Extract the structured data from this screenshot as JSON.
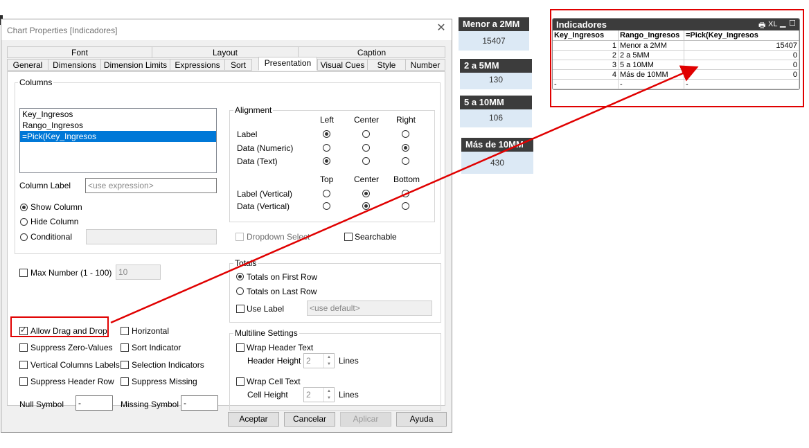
{
  "dialog": {
    "title": "Chart Properties [Indicadores]",
    "tabs_row1": [
      "Font",
      "Layout",
      "Caption"
    ],
    "tabs_row2": [
      "General",
      "Dimensions",
      "Dimension Limits",
      "Expressions",
      "Sort",
      "Presentation",
      "Visual Cues",
      "Style",
      "Number"
    ],
    "active_tab": "Presentation"
  },
  "columns": {
    "label": "Columns",
    "items": [
      "Key_Ingresos",
      "Rango_Ingresos",
      "=Pick(Key_Ingresos"
    ],
    "selected_index": 2,
    "column_label": "Column Label",
    "column_label_placeholder": "<use expression>",
    "show_column": "Show Column",
    "hide_column": "Hide Column",
    "conditional": "Conditional"
  },
  "alignment": {
    "label": "Alignment",
    "headers": [
      "Left",
      "Center",
      "Right"
    ],
    "rows": [
      "Label",
      "Data (Numeric)",
      "Data (Text)"
    ],
    "vheaders": [
      "Top",
      "Center",
      "Bottom"
    ],
    "vrows": [
      "Label (Vertical)",
      "Data (Vertical)"
    ],
    "dropdown_select": "Dropdown Select",
    "searchable": "Searchable"
  },
  "max_number": {
    "label": "Max Number (1 - 100)",
    "value": "10"
  },
  "totals": {
    "label": "Totals",
    "first_row": "Totals on First Row",
    "last_row": "Totals on Last Row",
    "use_label": "Use Label",
    "use_label_placeholder": "<use default>"
  },
  "options": {
    "allow_drag": "Allow Drag and Drop",
    "horizontal": "Horizontal",
    "suppress_zero": "Suppress Zero-Values",
    "sort_indicator": "Sort Indicator",
    "vertical_labels": "Vertical Columns Labels",
    "selection_indicators": "Selection Indicators",
    "suppress_header": "Suppress Header Row",
    "suppress_missing": "Suppress Missing",
    "null_symbol": "Null Symbol",
    "null_value": "-",
    "missing_symbol": "Missing Symbol",
    "missing_value": "-"
  },
  "multiline": {
    "label": "Multiline Settings",
    "wrap_header": "Wrap Header Text",
    "header_height": "Header Height",
    "header_value": "2",
    "lines1": "Lines",
    "wrap_cell": "Wrap Cell Text",
    "cell_height": "Cell Height",
    "cell_value": "2",
    "lines2": "Lines"
  },
  "buttons": {
    "accept": "Aceptar",
    "cancel": "Cancelar",
    "apply": "Aplicar",
    "help": "Ayuda"
  },
  "kpis": [
    {
      "title": "Menor a 2MM",
      "value": "15407"
    },
    {
      "title": "2 a 5MM",
      "value": "130"
    },
    {
      "title": "5 a 10MM",
      "value": "106"
    },
    {
      "title": "Más de 10MM",
      "value": "430"
    }
  ],
  "table": {
    "title": "Indicadores",
    "toolbar_xl": "XL",
    "headers": [
      "Key_Ingresos",
      "Rango_Ingresos",
      "=Pick(Key_Ingresos"
    ],
    "rows": [
      [
        "1",
        "Menor a 2MM",
        "15407"
      ],
      [
        "2",
        "2 a 5MM",
        "0"
      ],
      [
        "3",
        "5 a 10MM",
        "0"
      ],
      [
        "4",
        "Más de 10MM",
        "0"
      ],
      [
        "-",
        "-",
        "-"
      ]
    ]
  },
  "colors": {
    "annotation": "#e00000",
    "selection": "#0078d7",
    "kpi_header": "#3c3c3c",
    "kpi_body": "#dce9f5"
  }
}
